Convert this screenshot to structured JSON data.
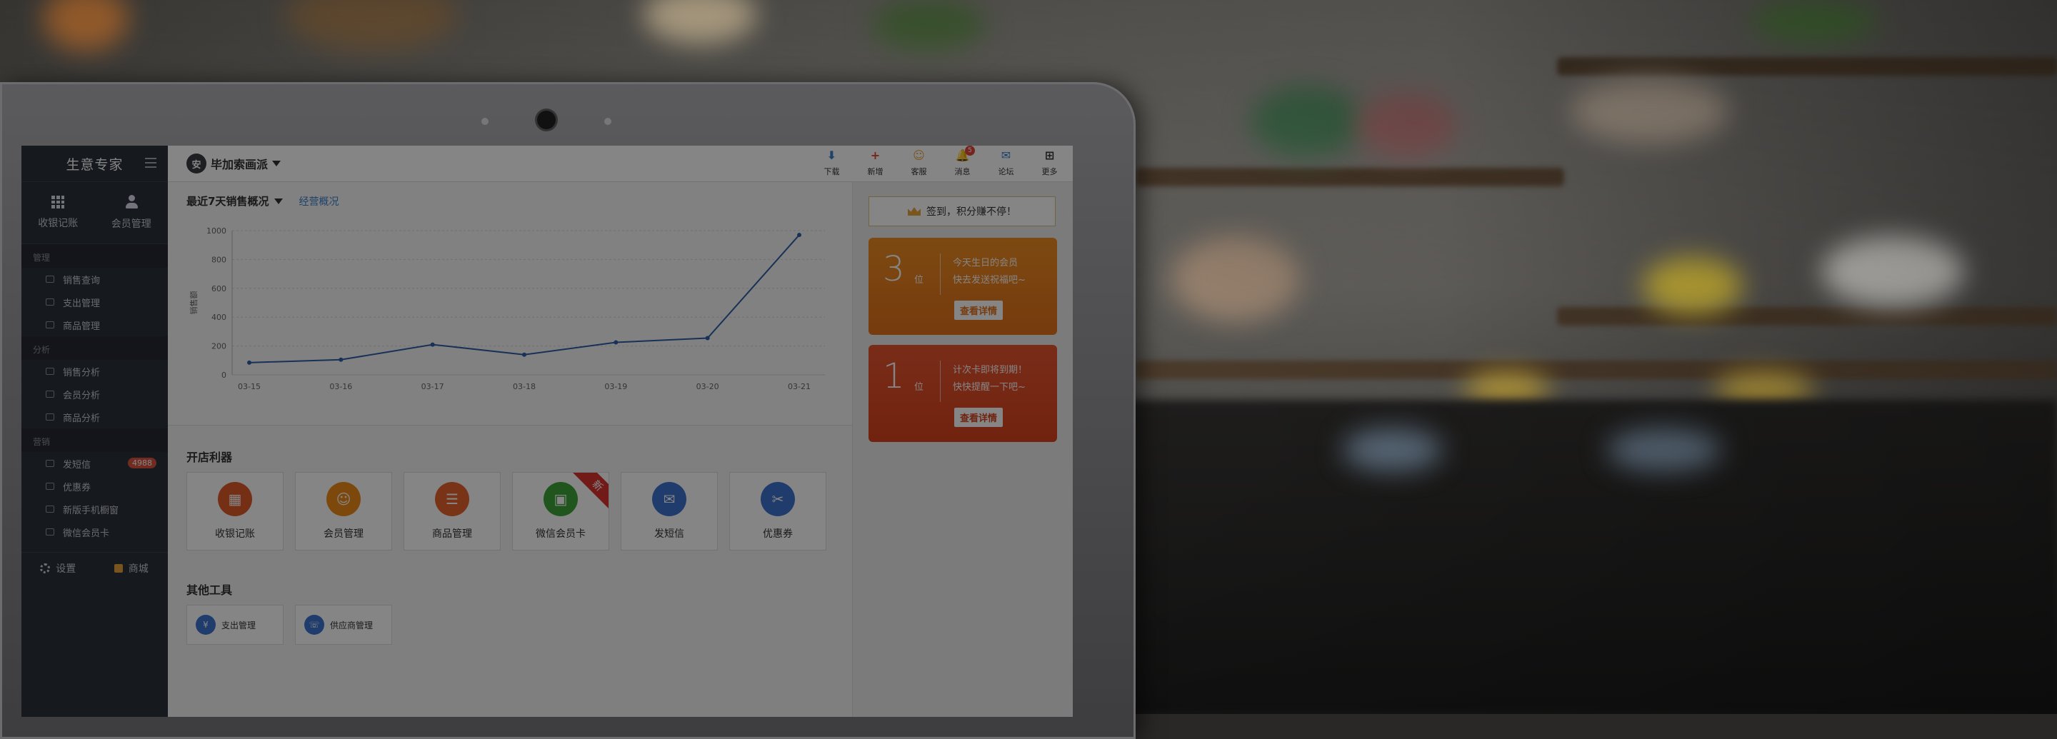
{
  "app": {
    "logo": "生意专家",
    "store_avatar": "安",
    "store_name": "毕加索画派"
  },
  "sidebar": {
    "quick": [
      {
        "label": "收银记账",
        "icon": "grid-icon"
      },
      {
        "label": "会员管理",
        "icon": "person-icon"
      }
    ],
    "groups": [
      {
        "title": "管理",
        "items": [
          {
            "label": "销售查询",
            "icon": "search-icon"
          },
          {
            "label": "支出管理",
            "icon": "expense-icon"
          },
          {
            "label": "商品管理",
            "icon": "list-icon"
          }
        ]
      },
      {
        "title": "分析",
        "items": [
          {
            "label": "销售分析",
            "icon": "trend-icon"
          },
          {
            "label": "会员分析",
            "icon": "member-analysis-icon"
          },
          {
            "label": "商品分析",
            "icon": "bar-icon"
          }
        ]
      },
      {
        "title": "营销",
        "items": [
          {
            "label": "发短信",
            "icon": "sms-icon",
            "badge": "4988"
          },
          {
            "label": "优惠券",
            "icon": "coupon-icon"
          },
          {
            "label": "新版手机橱窗",
            "icon": "phone-icon"
          },
          {
            "label": "微信会员卡",
            "icon": "wechat-card-icon"
          }
        ]
      }
    ],
    "footer": {
      "settings": "设置",
      "mall": "商城"
    }
  },
  "toolbar": [
    {
      "label": "下载",
      "glyph": "⬇",
      "color": "#3a7fc8",
      "icon": "download-icon"
    },
    {
      "label": "新增",
      "glyph": "+",
      "color": "#e2473b",
      "icon": "add-icon"
    },
    {
      "label": "客服",
      "glyph": "☺",
      "color": "#e7a83b",
      "icon": "service-icon"
    },
    {
      "label": "消息",
      "glyph": "🔔",
      "color": "#e2473b",
      "icon": "bell-icon",
      "badge": "5"
    },
    {
      "label": "论坛",
      "glyph": "✉",
      "color": "#3a7fc8",
      "icon": "forum-icon"
    },
    {
      "label": "更多",
      "glyph": "⊞",
      "color": "#333333",
      "icon": "more-icon"
    }
  ],
  "sales": {
    "title": "最近7天销售概况",
    "link": "经营概况"
  },
  "chart_data": {
    "type": "line",
    "title": "",
    "ylabel": "销售额",
    "xlabel": "",
    "x": [
      "03-15",
      "03-16",
      "03-17",
      "03-18",
      "03-19",
      "03-20",
      "03-21"
    ],
    "series": [
      {
        "values": [
          85,
          105,
          210,
          140,
          225,
          255,
          970
        ]
      }
    ],
    "ylim": [
      0,
      1000
    ],
    "yticks": [
      0,
      200,
      400,
      600,
      800,
      1000
    ],
    "grid": true,
    "color": "#2f5fa8"
  },
  "tools": {
    "title": "开店利器",
    "items": [
      {
        "label": "收银记账",
        "color": "#e05a2a",
        "glyph": "▦",
        "icon": "cashier-icon"
      },
      {
        "label": "会员管理",
        "color": "#ef8a17",
        "glyph": "☺",
        "icon": "member-icon"
      },
      {
        "label": "商品管理",
        "color": "#e9652e",
        "glyph": "☰",
        "icon": "goods-icon"
      },
      {
        "label": "微信会员卡",
        "color": "#3ea33a",
        "glyph": "▣",
        "icon": "wechat-icon",
        "ribbon": "新"
      },
      {
        "label": "发短信",
        "color": "#3c73d1",
        "glyph": "✉",
        "icon": "message-icon"
      },
      {
        "label": "优惠券",
        "color": "#3c73d1",
        "glyph": "✂",
        "icon": "coupon-icon"
      }
    ]
  },
  "other_tools": {
    "title": "其他工具",
    "items": [
      {
        "label": "支出管理",
        "glyph": "¥",
        "icon": "expense-icon"
      },
      {
        "label": "供应商管理",
        "glyph": "☏",
        "icon": "supplier-icon"
      }
    ]
  },
  "signin": {
    "label": "签到，积分赚不停！"
  },
  "promos": [
    {
      "number": "3",
      "unit": "位",
      "line1": "今天生日的会员",
      "line2": "快去发送祝福吧~",
      "button": "查看详情",
      "color_top": "#ef8d22",
      "color_bottom": "#e4711a"
    },
    {
      "number": "1",
      "unit": "位",
      "line1": "计次卡即将到期！",
      "line2": "快快提醒一下吧~",
      "button": "查看详情",
      "color_top": "#e8562f",
      "color_bottom": "#d9431f"
    }
  ]
}
